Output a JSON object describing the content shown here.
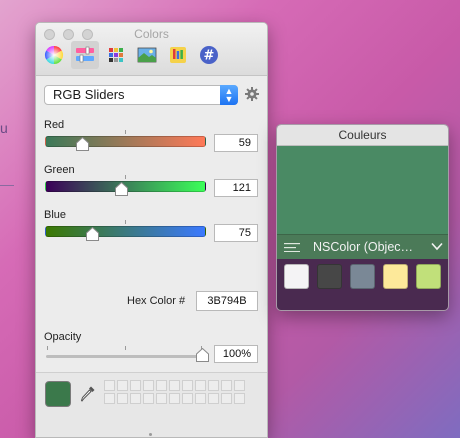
{
  "desktop": {
    "edge_glyph": "u"
  },
  "colors_panel": {
    "title": "Colors",
    "modes": [
      {
        "name": "color-wheel",
        "icon": "color-wheel-icon",
        "active": false
      },
      {
        "name": "color-sliders",
        "icon": "sliders-icon",
        "active": true
      },
      {
        "name": "color-palettes",
        "icon": "palettes-icon",
        "active": false
      },
      {
        "name": "image-palettes",
        "icon": "image-palettes-icon",
        "active": false
      },
      {
        "name": "pencils",
        "icon": "crayons-icon",
        "active": false
      },
      {
        "name": "hex-plugin",
        "icon": "hash-icon",
        "active": false
      }
    ],
    "slider_mode": {
      "selected": "RGB Sliders"
    },
    "sliders": {
      "red": {
        "label": "Red",
        "value": "59",
        "fraction": 0.231,
        "gradient": [
          "#3b7958",
          "#ff7958"
        ]
      },
      "green": {
        "label": "Green",
        "value": "121",
        "fraction": 0.475,
        "gradient": [
          "#3b0058",
          "#3bff58"
        ]
      },
      "blue": {
        "label": "Blue",
        "value": "75",
        "fraction": 0.294,
        "gradient": [
          "#3b7900",
          "#3b79ff"
        ]
      }
    },
    "hex": {
      "label": "Hex Color #",
      "value": "3B794B"
    },
    "opacity": {
      "label": "Opacity",
      "value": "100%",
      "fraction": 1.0
    },
    "current_color": "#3b794b",
    "swatch_grid": {
      "rows": 2,
      "cols": 11
    }
  },
  "couleurs_popover": {
    "title": "Couleurs",
    "preview_color": "#4a8a64",
    "format_label": "NSColor (Objec…",
    "swatches": [
      "#f4f3f5",
      "#474747",
      "#7a8896",
      "#fde99a",
      "#c1e07a"
    ]
  },
  "colors": {
    "accent": "#1c73f2",
    "background_top": "#e3a4cf",
    "background_bottom": "#7f6cc0"
  }
}
